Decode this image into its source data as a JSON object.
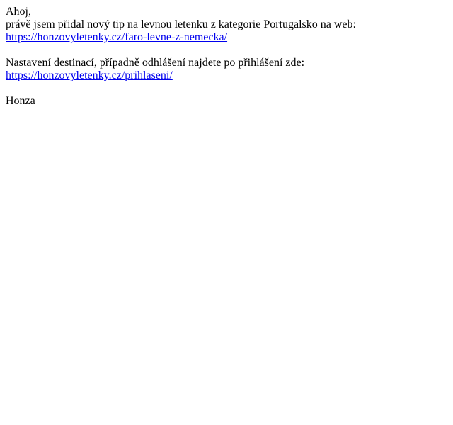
{
  "email": {
    "greeting": "Ahoj,",
    "intro": "právě jsem přidal nový tip na levnou letenku z kategorie Portugalsko na web:",
    "tip_link": "https://honzovyletenky.cz/faro-levne-z-nemecka/",
    "settings_text": "Nastavení destinací, případně odhlášení najdete po přihlášení zde:",
    "login_link": "https://honzovyletenky.cz/prihlaseni/",
    "signature": "Honza"
  },
  "colors": {
    "text": "#000000",
    "link": "#0000ee",
    "background": "#ffffff"
  }
}
